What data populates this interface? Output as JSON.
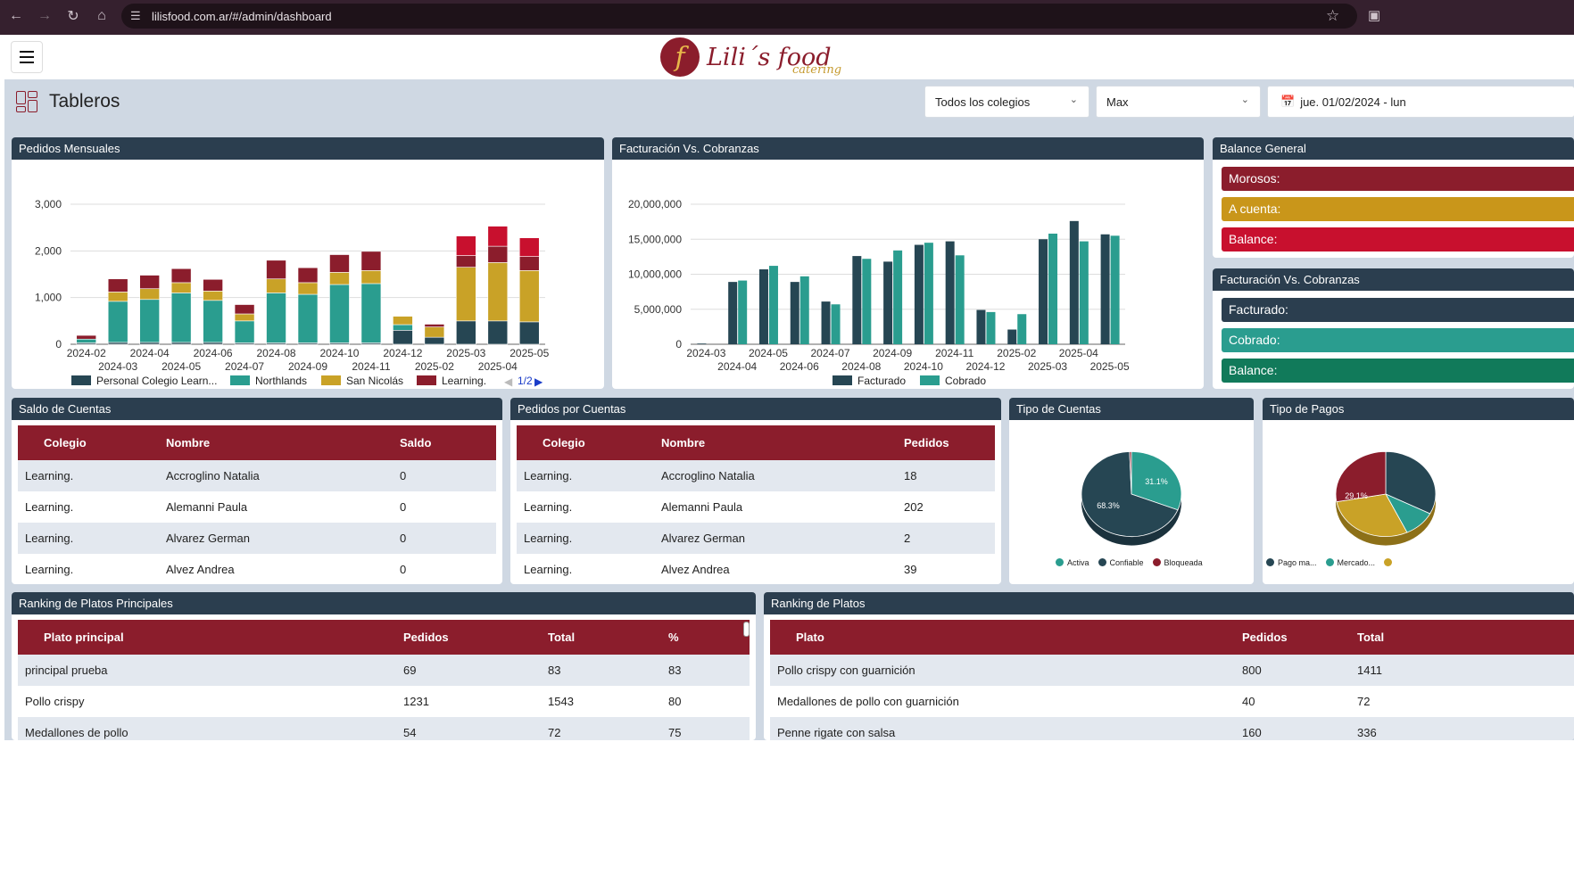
{
  "browser": {
    "url": "lilisfood.com.ar/#/admin/dashboard",
    "icons": [
      "back-icon",
      "forward-icon",
      "reload-icon",
      "home-icon",
      "site-info-icon",
      "star-icon",
      "extensions-icon"
    ]
  },
  "header": {
    "logo_text": "Lili´s food",
    "logo_sub": "catering",
    "logo_mark": "f"
  },
  "page": {
    "title": "Tableros",
    "filters": {
      "colegio": "Todos los colegios",
      "periodo": "Max",
      "fecha": "jue. 01/02/2024 - lun"
    }
  },
  "colors": {
    "header_bg": "#2b3e4f",
    "brand": "#8b1d2c",
    "dark_teal": "#264653",
    "teal": "#2a9d8f",
    "gold": "#c9a227",
    "maroon": "#8b1d2c",
    "red": "#c8102e"
  },
  "pedidos_mensuales": {
    "title": "Pedidos Mensuales",
    "legend": [
      "Personal Colegio Learn...",
      "Northlands",
      "San Nicolás",
      "Learning."
    ],
    "pager": "1/2"
  },
  "facturacion": {
    "title": "Facturación Vs. Cobranzas",
    "legend": [
      "Facturado",
      "Cobrado"
    ]
  },
  "chart_data": [
    {
      "type": "bar",
      "stacked": true,
      "title": "",
      "categories": [
        "2024-02",
        "2024-03",
        "2024-04",
        "2024-05",
        "2024-06",
        "2024-07",
        "2024-08",
        "2024-09",
        "2024-10",
        "2024-11",
        "2024-12",
        "2025-02",
        "2025-03",
        "2025-04",
        "2025-05"
      ],
      "yticks": [
        "0",
        "1,000",
        "2,000",
        "3,000"
      ],
      "ylim": [
        0,
        3000
      ],
      "grid": true,
      "legend_position": "bottom",
      "series": [
        {
          "name": "Personal Colegio Learn...",
          "color": "#264653",
          "values": [
            30,
            40,
            40,
            40,
            40,
            30,
            30,
            30,
            30,
            30,
            300,
            150,
            500,
            500,
            480
          ]
        },
        {
          "name": "Northlands",
          "color": "#2a9d8f",
          "values": [
            80,
            880,
            920,
            1060,
            900,
            470,
            1070,
            1040,
            1250,
            1270,
            120,
            0,
            0,
            0,
            0
          ]
        },
        {
          "name": "San Nicolás",
          "color": "#c9a227",
          "values": [
            0,
            200,
            230,
            220,
            200,
            150,
            300,
            250,
            260,
            280,
            180,
            220,
            1150,
            1250,
            1100
          ]
        },
        {
          "name": "Learning.",
          "color": "#8b1d2c",
          "values": [
            80,
            280,
            290,
            300,
            250,
            200,
            400,
            320,
            380,
            410,
            0,
            60,
            250,
            350,
            300
          ]
        },
        {
          "name": "",
          "color": "#c8102e",
          "values": [
            0,
            0,
            0,
            0,
            0,
            0,
            0,
            0,
            0,
            0,
            0,
            0,
            420,
            430,
            400
          ]
        }
      ]
    },
    {
      "type": "bar",
      "title": "",
      "categories": [
        "2024-03",
        "2024-04",
        "2024-05",
        "2024-06",
        "2024-07",
        "2024-08",
        "2024-09",
        "2024-10",
        "2024-11",
        "2024-12",
        "2025-02",
        "2025-03",
        "2025-04",
        "2025-05"
      ],
      "yticks": [
        "0",
        "5,000,000",
        "10,000,000",
        "15,000,000",
        "20,000,000"
      ],
      "ylim": [
        0,
        20000000
      ],
      "grid": true,
      "legend_position": "bottom",
      "series": [
        {
          "name": "Facturado",
          "color": "#264653",
          "values": [
            100000,
            8900000,
            10700000,
            8900000,
            6100000,
            12600000,
            11800000,
            14200000,
            14700000,
            4900000,
            2100000,
            15000000,
            17600000,
            15700000
          ]
        },
        {
          "name": "Cobrado",
          "color": "#2a9d8f",
          "values": [
            0,
            9100000,
            11200000,
            9700000,
            5700000,
            12200000,
            13400000,
            14500000,
            12700000,
            4600000,
            4300000,
            15800000,
            14700000,
            15500000
          ]
        }
      ]
    },
    {
      "type": "pie",
      "title": "",
      "categories": [
        "Activa",
        "Confiable",
        "Bloqueada"
      ],
      "values": [
        31.1,
        68.3,
        0.6
      ],
      "labels": [
        "31.1%",
        "68.3%",
        ""
      ],
      "colors": [
        "#2a9d8f",
        "#264653",
        "#8b1d2c"
      ]
    },
    {
      "type": "pie",
      "title": "",
      "categories": [
        "Pago ma...",
        "Mercado..."
      ],
      "labels": [
        "29.1%"
      ]
    }
  ],
  "balance_general": {
    "title": "Balance General",
    "items": [
      {
        "label": "Morosos:",
        "color": "#8b1d2c"
      },
      {
        "label": "A cuenta:",
        "color": "#c9961a"
      },
      {
        "label": "Balance:",
        "color": "#c8102e"
      }
    ]
  },
  "facturacion_small": {
    "title": "Facturación Vs. Cobranzas",
    "items": [
      {
        "label": "Facturado:",
        "color": "#2b3e4f"
      },
      {
        "label": "Cobrado:",
        "color": "#2a9d8f"
      },
      {
        "label": "Balance:",
        "color": "#117a5a"
      }
    ]
  },
  "saldo_cuentas": {
    "title": "Saldo de Cuentas",
    "headers": [
      "Colegio",
      "Nombre",
      "Saldo"
    ],
    "rows": [
      [
        "Learning.",
        "Accroglino Natalia",
        "0"
      ],
      [
        "Learning.",
        "Alemanni Paula",
        "0"
      ],
      [
        "Learning.",
        "Alvarez German",
        "0"
      ],
      [
        "Learning.",
        "Alvez Andrea",
        "0"
      ]
    ]
  },
  "pedidos_cuentas": {
    "title": "Pedidos por Cuentas",
    "headers": [
      "Colegio",
      "Nombre",
      "Pedidos"
    ],
    "rows": [
      [
        "Learning.",
        "Accroglino Natalia",
        "18"
      ],
      [
        "Learning.",
        "Alemanni Paula",
        "202"
      ],
      [
        "Learning.",
        "Alvarez German",
        "2"
      ],
      [
        "Learning.",
        "Alvez Andrea",
        "39"
      ]
    ]
  },
  "tipo_cuentas": {
    "title": "Tipo de Cuentas",
    "legend": [
      "Activa",
      "Confiable",
      "Bloqueada"
    ]
  },
  "tipo_pagos": {
    "title": "Tipo de Pagos",
    "legend": [
      "Pago ma...",
      "Mercado..."
    ]
  },
  "ranking_principales": {
    "title": "Ranking de Platos Principales",
    "headers": [
      "Plato principal",
      "Pedidos",
      "Total",
      "%"
    ],
    "rows": [
      [
        "principal prueba",
        "69",
        "83",
        "83"
      ],
      [
        "Pollo crispy",
        "1231",
        "1543",
        "80"
      ],
      [
        "Medallones de pollo",
        "54",
        "72",
        "75"
      ]
    ]
  },
  "ranking_platos": {
    "title": "Ranking de Platos",
    "headers": [
      "Plato",
      "Pedidos",
      "Total"
    ],
    "rows": [
      [
        "Pollo crispy con guarnición",
        "800",
        "1411"
      ],
      [
        "Medallones de pollo con guarnición",
        "40",
        "72"
      ],
      [
        "Penne rigate con salsa",
        "160",
        "336"
      ]
    ]
  }
}
